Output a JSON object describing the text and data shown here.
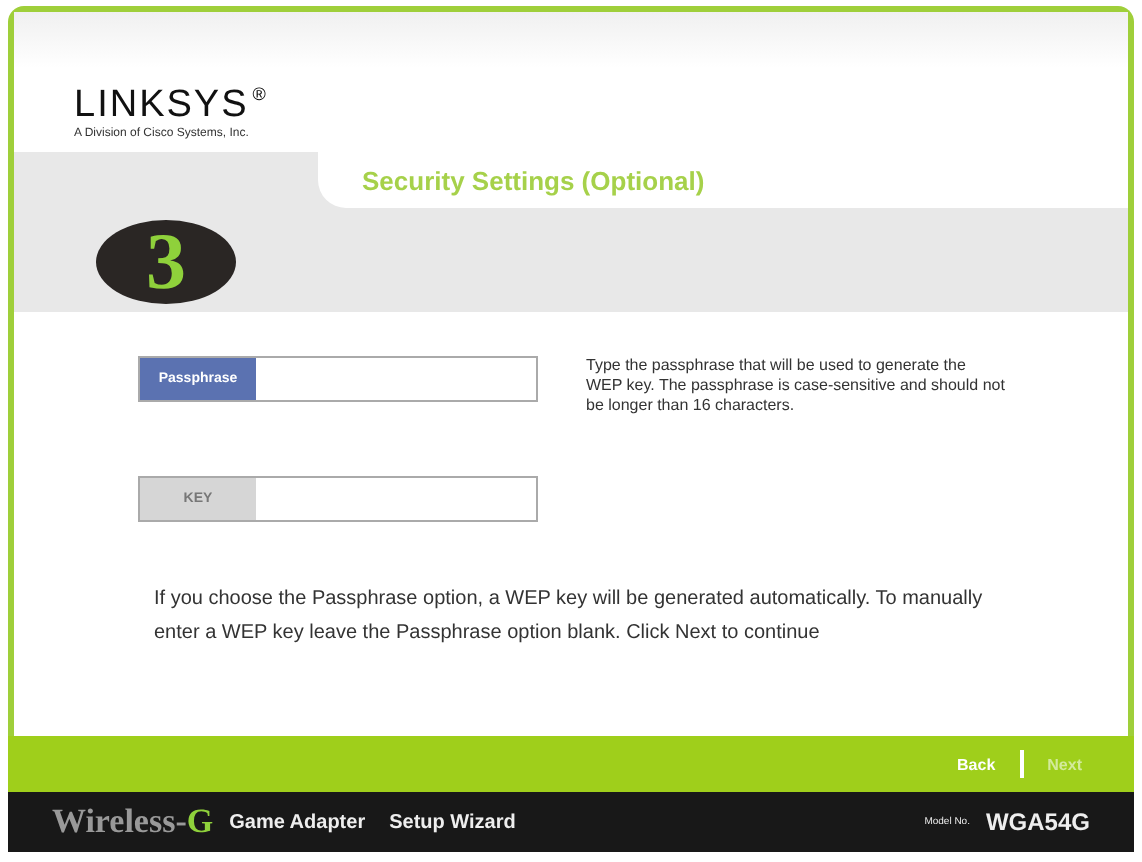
{
  "brand": {
    "logo": "LINKSYS",
    "registered": "®",
    "tagline": "A Division of Cisco Systems, Inc."
  },
  "step": {
    "number": "3",
    "title": "Security Settings (Optional)"
  },
  "fields": [
    {
      "label": "Passphrase",
      "disabled": false
    },
    {
      "label": "KEY",
      "disabled": true
    }
  ],
  "help": "Type the passphrase that will be used to generate the WEP key.  The passphrase is case-sensitive and should not be longer than 16 characters.",
  "note": "If you choose the Passphrase option, a WEP key will be generated automatically. To manually enter a WEP key leave the Passphrase option blank. Click Next to continue",
  "nav": [
    {
      "label": "Back",
      "disabled": false
    },
    {
      "label": "Next",
      "disabled": true
    }
  ],
  "footer": {
    "product": "Wireless-",
    "product_suffix": "G",
    "device": "Game Adapter",
    "wizard": "Setup Wizard",
    "model_label": "Model No.",
    "model": "WGA54G"
  }
}
